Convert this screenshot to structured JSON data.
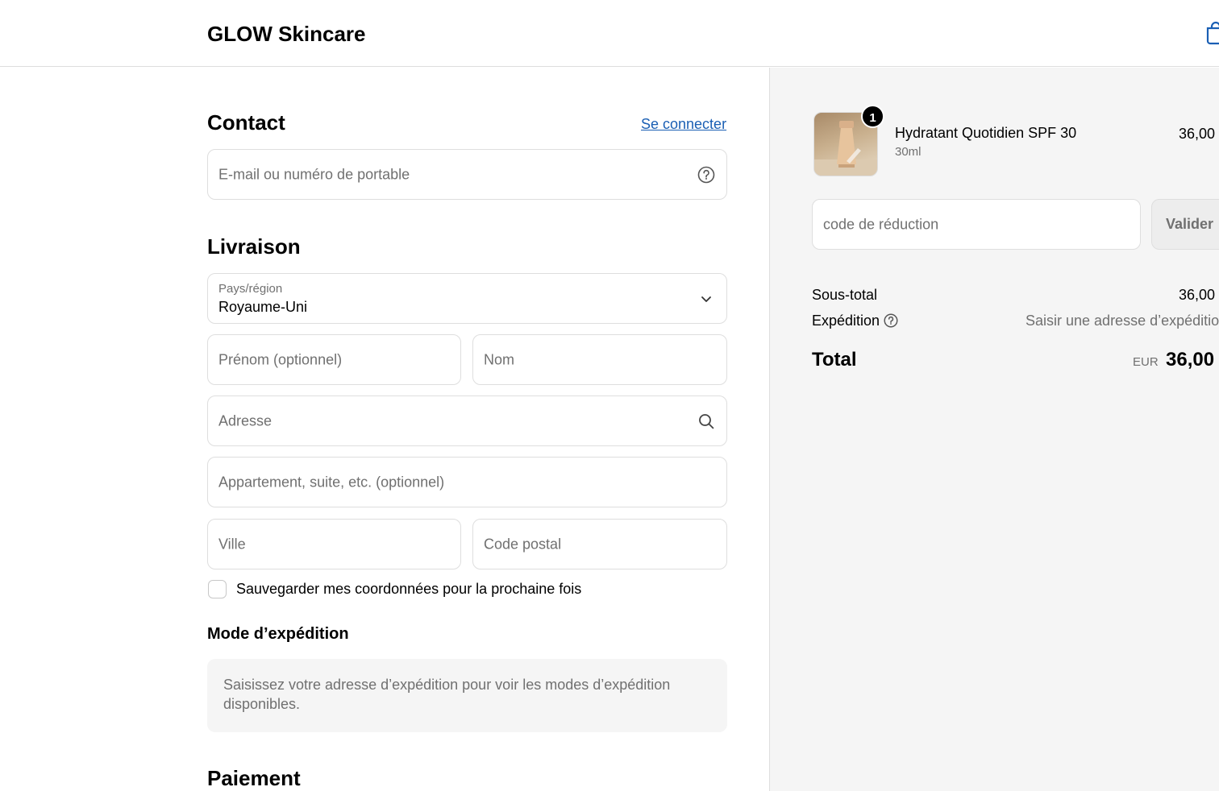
{
  "header": {
    "brand": "GLOW Skincare",
    "cart_icon": "shopping-bag-icon"
  },
  "contact": {
    "title": "Contact",
    "login_link": "Se connecter",
    "email_placeholder": "E-mail ou numéro de portable",
    "help_icon": "question-circle-icon"
  },
  "delivery": {
    "title": "Livraison",
    "country_label": "Pays/région",
    "country_value": "Royaume-Uni",
    "first_name_placeholder": "Prénom (optionnel)",
    "last_name_placeholder": "Nom",
    "address_placeholder": "Adresse",
    "apartment_placeholder": "Appartement, suite, etc. (optionnel)",
    "city_placeholder": "Ville",
    "postal_placeholder": "Code postal",
    "save_info_label": "Sauvegarder mes coordonnées pour la prochaine fois"
  },
  "shipping_method": {
    "title": "Mode d’expédition",
    "info": "Saisissez votre adresse d’expédition pour voir les modes d’expédition disponibles."
  },
  "payment": {
    "title": "Paiement"
  },
  "summary": {
    "item": {
      "quantity": "1",
      "name": "Hydratant Quotidien SPF 30",
      "variant": "30ml",
      "price": "36,00"
    },
    "discount_placeholder": "code de réduction",
    "apply_label": "Valider",
    "subtotal_label": "Sous-total",
    "subtotal_value": "36,00",
    "shipping_label": "Expédition",
    "shipping_value": "Saisir une adresse d’expéditio",
    "total_label": "Total",
    "currency": "EUR",
    "total_value": "36,00"
  },
  "colors": {
    "link": "#1a5fb4",
    "panel_bg": "#f5f5f5",
    "border": "#dedede",
    "muted_text": "#707070"
  }
}
